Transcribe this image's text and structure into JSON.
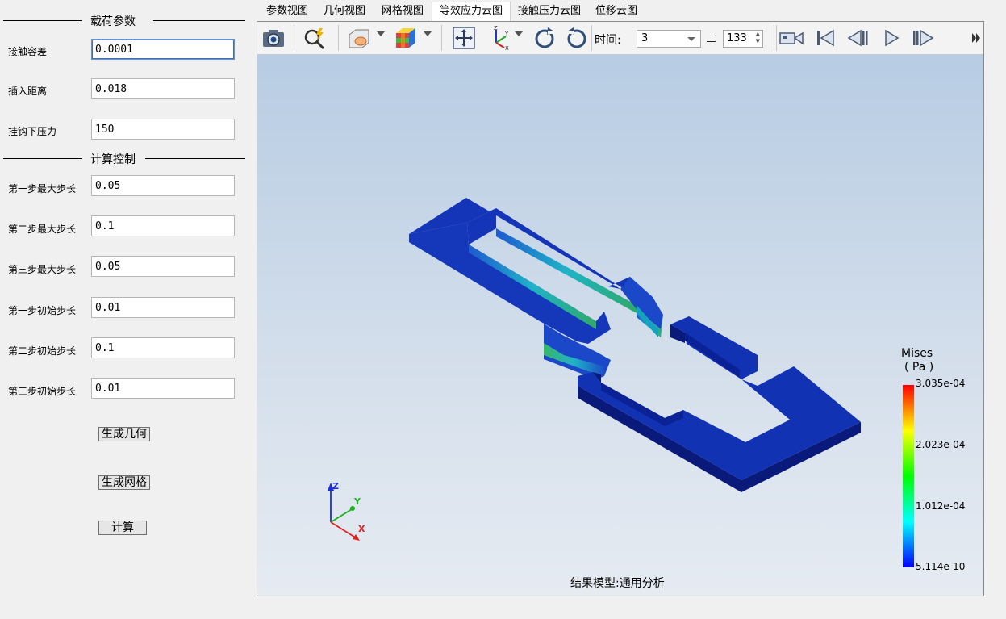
{
  "left_panel": {
    "load_section_title": "载荷参数",
    "calc_section_title": "计算控制",
    "fields": [
      {
        "label": "接触容差",
        "value": "0.0001"
      },
      {
        "label": "插入距离",
        "value": "0.018"
      },
      {
        "label": "挂钩下压力",
        "value": "150"
      },
      {
        "label": "第一步最大步长",
        "value": "0.05"
      },
      {
        "label": "第二步最大步长",
        "value": "0.1"
      },
      {
        "label": "第三步最大步长",
        "value": "0.05"
      },
      {
        "label": "第一步初始步长",
        "value": "0.01"
      },
      {
        "label": "第二步初始步长",
        "value": "0.1"
      },
      {
        "label": "第三步初始步长",
        "value": "0.01"
      }
    ],
    "buttons": {
      "generate_geometry": "生成几何",
      "generate_mesh": "生成网格",
      "compute": "计算"
    }
  },
  "tabs": [
    {
      "label": "参数视图",
      "active": false
    },
    {
      "label": "几何视图",
      "active": false
    },
    {
      "label": "网格视图",
      "active": false
    },
    {
      "label": "等效应力云图",
      "active": true
    },
    {
      "label": "接触压力云图",
      "active": false
    },
    {
      "label": "位移云图",
      "active": false
    }
  ],
  "toolbar": {
    "time_label": "时间:",
    "time_value": "3",
    "frame_value": "133"
  },
  "scene": {
    "model_caption": "结果模型:通用分析",
    "axes": {
      "x": "X",
      "y": "Y",
      "z": "Z"
    }
  },
  "legend": {
    "title": "Mises",
    "unit": "( Pa )",
    "max": "3.035e-04",
    "mid_high": "2.023e-04",
    "mid_low": "1.012e-04",
    "min": "5.114e-10",
    "colors": [
      "#ff0000",
      "#ffff00",
      "#00ff00",
      "#00ffff",
      "#0000ff"
    ]
  },
  "colors": {
    "model_top": "#1536b8",
    "model_side": "#0a1f8e",
    "accent_focus": "#3e6fbd"
  }
}
